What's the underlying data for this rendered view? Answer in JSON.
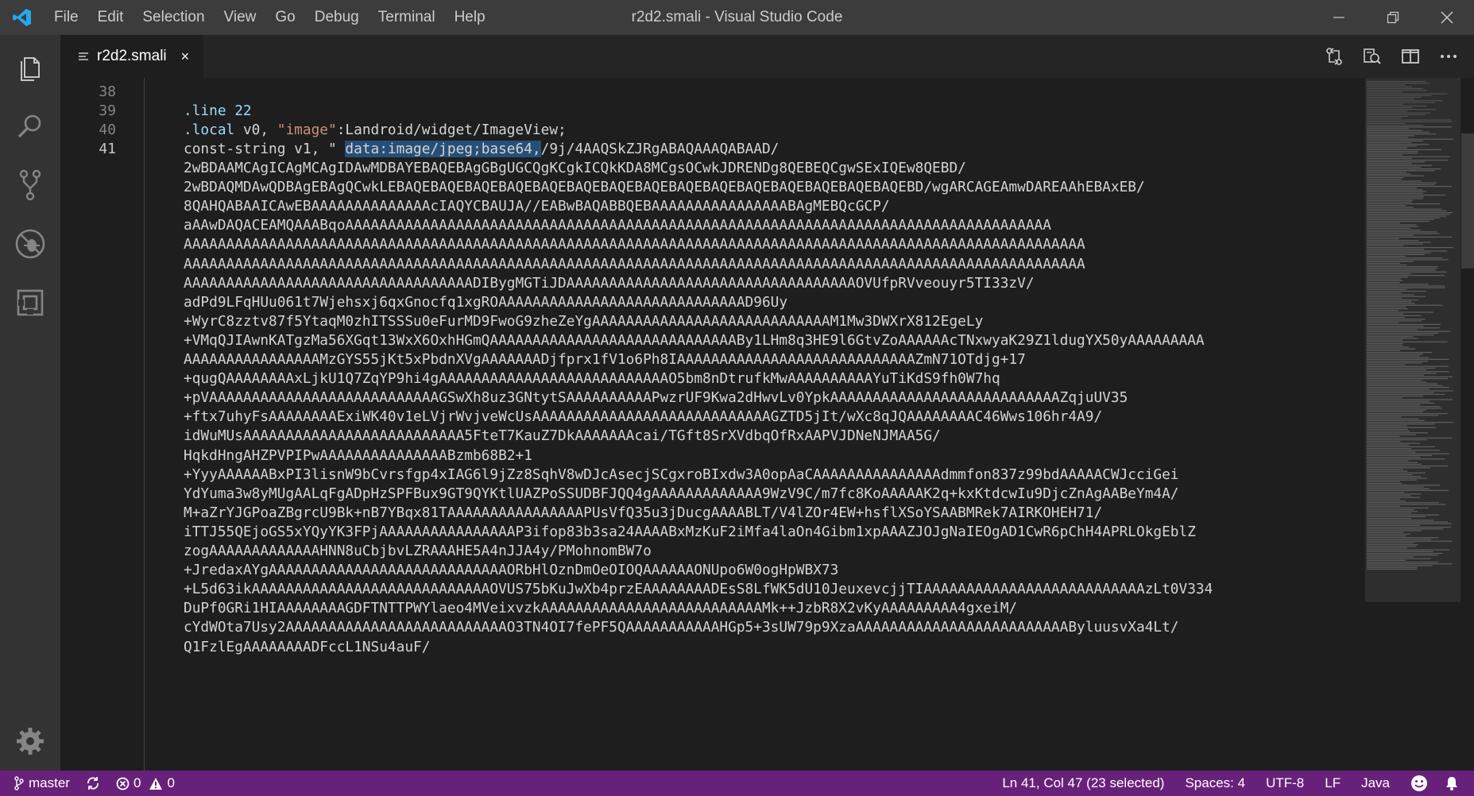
{
  "window": {
    "title": "r2d2.smali - Visual Studio Code"
  },
  "menu": [
    "File",
    "Edit",
    "Selection",
    "View",
    "Go",
    "Debug",
    "Terminal",
    "Help"
  ],
  "tab": {
    "label": "r2d2.smali",
    "close": "×"
  },
  "editor": {
    "line_numbers": [
      "38",
      "39",
      "40",
      "41"
    ],
    "lines": {
      "l39": ".line 22",
      "l40_kw": ".local",
      "l40_rest": " v0, ",
      "l40_str": "\"image\"",
      "l40_tail": ":Landroid/widget/ImageView;",
      "l41_pre": "const-string v1, \" ",
      "l41_sel": "data:image/jpeg;base64,",
      "l41_post": "/9j/4AAQSkZJRgABAQAAAQABAAD/"
    },
    "wrapped": [
      "2wBDAAMCAgICAgMCAgIDAwMDBAYEBAQEBAgGBgUGCQgKCgkICQkKDA8MCgsOCwkJDRENDg8QEBEQCgwSExIQEw8QEBD/",
      "2wBDAQMDAwQDBAgEBAgQCwkLEBAQEBAQEBAQEBAQEBAQEBAQEBAQEBAQEBAQEBAQEBAQEBAQEBAQEBAQEBAQEBD/wgARCAGEAmwDAREAAhEBAxEB/",
      "8QAHQABAAICAwEBAAAAAAAAAAAAAAcIAQYCBAUJA//EABwBAQABBQEBAAAAAAAAAAAAAAAABAgMEBQcGCP/",
      "aAAwDAQACEAMQAAABqoAAAAAAAAAAAAAAAAAAAAAAAAAAAAAAAAAAAAAAAAAAAAAAAAAAAAAAAAAAAAAAAAAAAAAAAAAAAAAAAAAAA",
      "AAAAAAAAAAAAAAAAAAAAAAAAAAAAAAAAAAAAAAAAAAAAAAAAAAAAAAAAAAAAAAAAAAAAAAAAAAAAAAAAAAAAAAAAAAAAAAAAAAAAAAAAAA",
      "AAAAAAAAAAAAAAAAAAAAAAAAAAAAAAAAAAAAAAAAAAAAAAAAAAAAAAAAAAAAAAAAAAAAAAAAAAAAAAAAAAAAAAAAAAAAAAAAAAAAAAAAAA",
      "AAAAAAAAAAAAAAAAAAAAAAAAAAAAAAAAAADIBygMGTiJDAAAAAAAAAAAAAAAAAAAAAAAAAAAAAAAAAAOVUfpRVveouyr5TI33zV/",
      "adPd9LFqHUu061t7Wjehsxj6qxGnocfq1xgROAAAAAAAAAAAAAAAAAAAAAAAAAAAAAD96Uy",
      "+WyrC8zztv87f5YtaqM0zhITSSSu0eFurMD9FwoG9zheZeYgAAAAAAAAAAAAAAAAAAAAAAAAAAAAM1Mw3DWXrX812EgeLy",
      "+VMqQJIAwnKATgzMa56XGqt13WxX6OxhHGmQAAAAAAAAAAAAAAAAAAAAAAAAAAAAABy1LHm8q3HE9l6GtvZoAAAAAAcTNxwyaK29Z1ldugYX50yAAAAAAAAA",
      "AAAAAAAAAAAAAAAAMzGYS55jKt5xPbdnXVgAAAAAAADjfprx1fV1o6Ph8IAAAAAAAAAAAAAAAAAAAAAAAAAAAAZmN71OTdjg+17",
      "+qugQAAAAAAAAxLjkU1Q7ZqYP9hi4gAAAAAAAAAAAAAAAAAAAAAAAAAAAO5bm8nDtrufkMwAAAAAAAAAAYuTiKdS9fh0W7hq",
      "+pVAAAAAAAAAAAAAAAAAAAAAAAAAAAGSwXh8uz3GNtytSAAAAAAAAAAPwzrUF9Kwa2dHwvLv0YpkAAAAAAAAAAAAAAAAAAAAAAAAAAAZqjuUV35",
      "+ftx7uhyFsAAAAAAAAExiWK40v1eLVjrWvjveWcUsAAAAAAAAAAAAAAAAAAAAAAAAAAAAGZTD5jIt/wXc8qJQAAAAAAAAC46Wws106hr4A9/",
      "idWuMUsAAAAAAAAAAAAAAAAAAAAAAAAAA5FteT7KauZ7DkAAAAAAAcai/TGft8SrXVdbqOfRxAAPVJDNeNJMAA5G/",
      "HqkdHngAHZPVPIPwAAAAAAAAAAAAAAABzmb68B2+1",
      "+YyyAAAAAABxPI3lisnW9bCvrsfgp4xIAG6l9jZz8SqhV8wDJcAsecjSCgxroBIxdw3A0opAaCAAAAAAAAAAAAAAAdmmfon837z99bdAAAAACWJcciGei",
      "YdYuma3w8yMUgAALqFgADpHzSPFBux9GT9QYKtlUAZPoSSUDBFJQQ4gAAAAAAAAAAAAA9WzV9C/m7fc8KoAAAAAK2q+kxKtdcwIu9DjcZnAgAABeYm4A/",
      "M+aZrYJGPoaZBgrcU9Bk+nB7YBqx81TAAAAAAAAAAAAAAAAPUsVfQ35u3jDucgAAAABLT/V4lZOr4EW+hsflXSoYSAABMRek7AIRKOHEH71/",
      "iTTJ55QEjoGS5xYQyYK3FPjAAAAAAAAAAAAAAAAP3ifop83b3sa24AAAABxMzKuF2iMfa4laOn4Gibm1xpAAAZJOJgNaIEOgAD1CwR6pChH4APRLOkgEblZ",
      "zogAAAAAAAAAAAAAHNN8uCbjbvLZRAAAHE5A4nJJA4y/PMohnomBW7o",
      "+JredaxAYgAAAAAAAAAAAAAAAAAAAAAAAAAAAAORbHlOznDmOeOIOQAAAAAAONUpo6W0ogHpWBX73",
      "+L5d63ikAAAAAAAAAAAAAAAAAAAAAAAAAAAAOVUS75bKuJwXb4przEAAAAAAAADEsS8LfWK5dU10JeuxevcjjTIAAAAAAAAAAAAAAAAAAAAAAAAAAzLt0V334",
      "DuPf0GRi1HIAAAAAAAAGDFTNTTPWYlaeo4MVeixvzkAAAAAAAAAAAAAAAAAAAAAAAAAAMk++JzbR8X2vKyAAAAAAAAA4gxeiM/",
      "cYdWOta7Usy2AAAAAAAAAAAAAAAAAAAAAAAAAAO3TN4OI7fePF5QAAAAAAAAAAAHGp5+3sUW79p9XzaAAAAAAAAAAAAAAAAAAAAAAAAAByluusvXa4Lt/",
      "Q1FzlEgAAAAAAAADFccL1NSu4auF/"
    ]
  },
  "status": {
    "branch": "master",
    "errors": "0",
    "warnings": "0",
    "position": "Ln 41, Col 47 (23 selected)",
    "spaces": "Spaces: 4",
    "encoding": "UTF-8",
    "eol": "LF",
    "language": "Java"
  },
  "colors": {
    "titlebar": "#3c3c3c",
    "activitybar": "#333333",
    "statusbar": "#68217a",
    "editor": "#1e1e1e",
    "selection": "#264f78"
  }
}
